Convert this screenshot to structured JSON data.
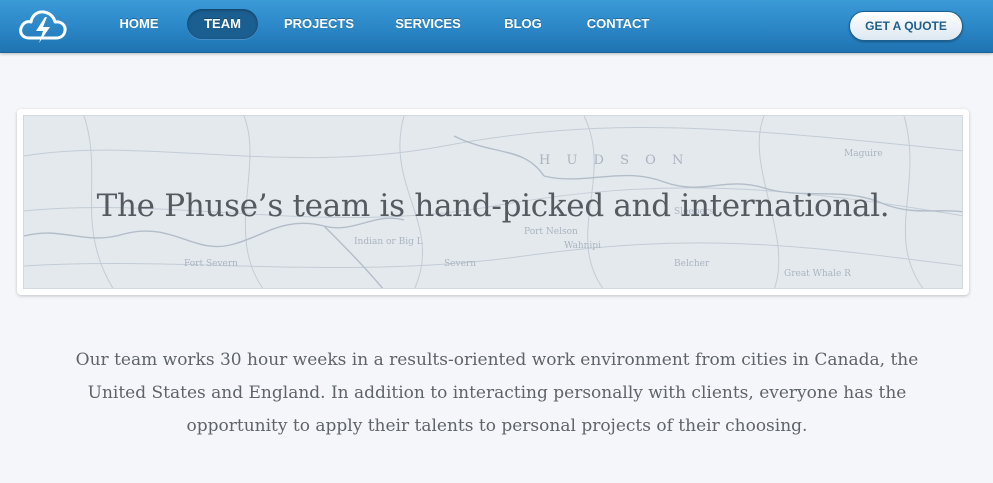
{
  "nav": {
    "items": [
      {
        "label": "HOME",
        "active": false
      },
      {
        "label": "TEAM",
        "active": true
      },
      {
        "label": "PROJECTS",
        "active": false
      },
      {
        "label": "SERVICES",
        "active": false
      },
      {
        "label": "BLOG",
        "active": false
      },
      {
        "label": "CONTACT",
        "active": false
      }
    ],
    "cta_label": "GET A QUOTE",
    "logo_icon": "cloud-lightning-icon"
  },
  "banner": {
    "headline": "The Phuse’s team is hand-picked and international.",
    "background": "vintage-map-illustration",
    "map_labels": [
      "H U D S O N",
      "Indian or Big L",
      "Port Nelson",
      "Wahnipi",
      "Sleepers",
      "Belcher",
      "Great Whale R",
      "Severn",
      "Fort Severn",
      "Maguire"
    ]
  },
  "intro": {
    "lines": [
      "Our team works 30 hour weeks in a results-oriented work environment from cities in Canada,  the",
      "United States and England.  In addition to interacting personally with clients,  everyone has the",
      "opportunity to apply their talents to personal projects of their choosing."
    ]
  },
  "colors": {
    "topbar": "#2b86c6",
    "active_tab": "#1b5f91",
    "page_background": "#f4f6f9",
    "headline_text": "#555a60",
    "body_text": "#5f6469"
  }
}
